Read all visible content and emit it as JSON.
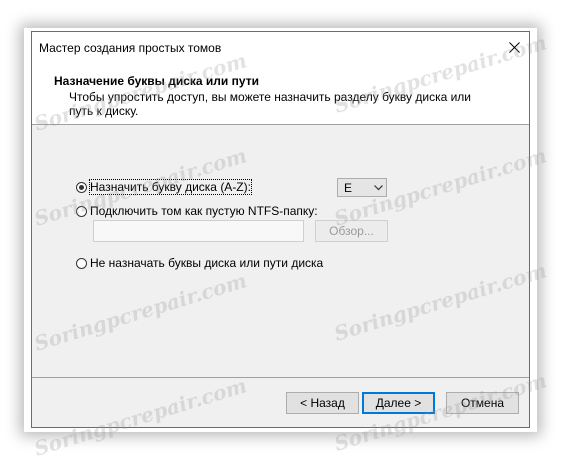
{
  "window": {
    "title": "Мастер создания простых томов"
  },
  "header": {
    "title": "Назначение буквы диска или пути",
    "description": "Чтобы упростить доступ, вы можете назначить разделу букву диска или путь к диску."
  },
  "options": {
    "assign_letter": {
      "label": "Назначить букву диска (A-Z):",
      "selected": true
    },
    "mount_folder": {
      "label": "Подключить том как пустую NTFS-папку:",
      "selected": false
    },
    "no_assign": {
      "label": "Не назначать буквы диска или пути диска",
      "selected": false
    }
  },
  "drive_letter": {
    "value": "E"
  },
  "folder_path": {
    "value": ""
  },
  "browse": {
    "label": "Обзор..."
  },
  "buttons": {
    "back": "< Назад",
    "next": "Далее >",
    "cancel": "Отмена"
  },
  "watermark": {
    "text": "Soringpcrepair.com"
  }
}
